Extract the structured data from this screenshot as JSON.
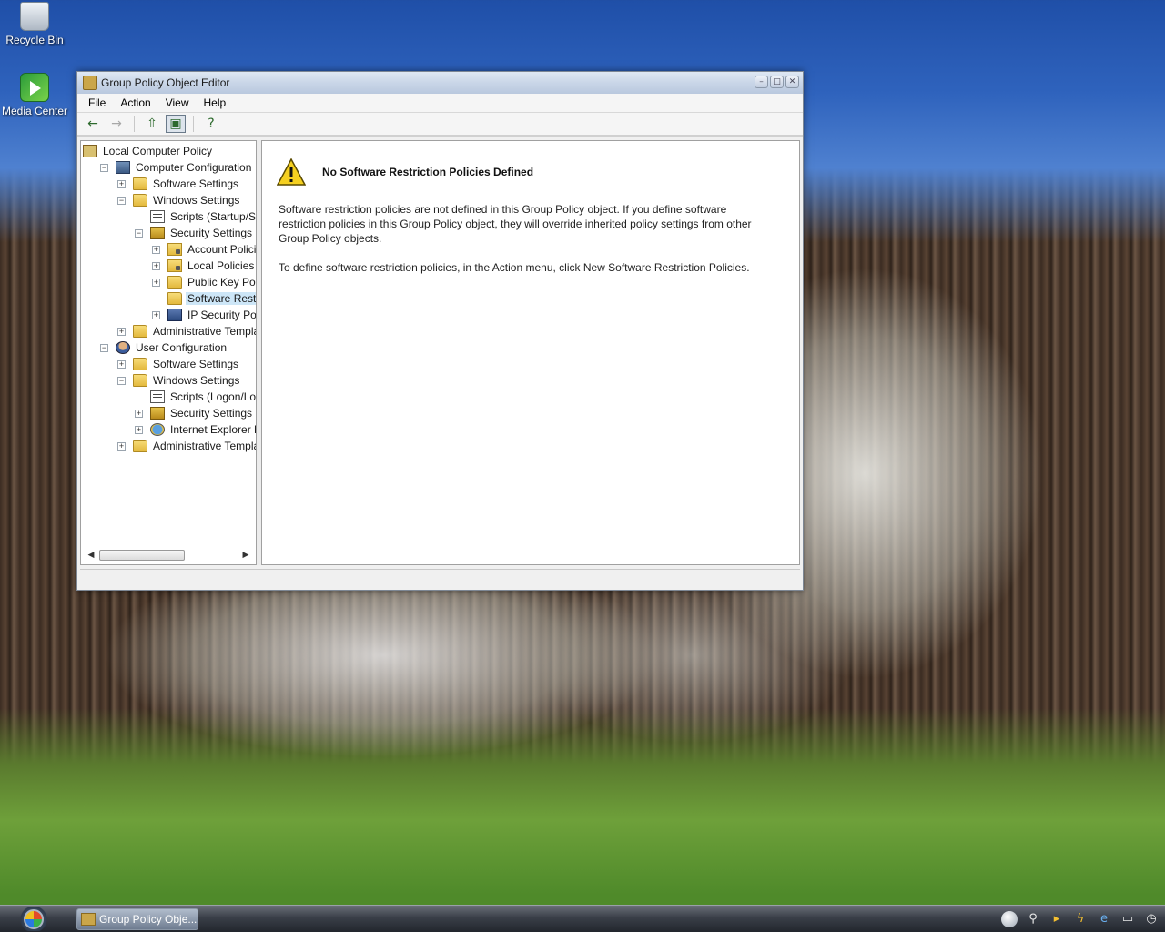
{
  "desktop": {
    "icons": [
      {
        "label": "Recycle Bin",
        "icon": "recycle-bin-icon"
      },
      {
        "label": "Media Center",
        "icon": "media-center-icon"
      }
    ]
  },
  "window": {
    "title": "Group Policy Object Editor",
    "controls": {
      "minimize": "–",
      "maximize": "□",
      "close": "✕"
    },
    "menu": [
      "File",
      "Action",
      "View",
      "Help"
    ],
    "toolbar": {
      "back": "←",
      "forward": "→",
      "up": "⇧",
      "show_hide": "▣",
      "help": "?"
    },
    "tree": {
      "nodes": [
        {
          "label": "Local Computer Policy",
          "icon": "policy-icon",
          "expander": ""
        },
        {
          "label": "Computer Configuration",
          "icon": "computer-icon",
          "expander": "−"
        },
        {
          "label": "Software Settings",
          "icon": "folder-icon",
          "expander": "+"
        },
        {
          "label": "Windows Settings",
          "icon": "folder-icon",
          "expander": "−"
        },
        {
          "label": "Scripts (Startup/Shut",
          "icon": "script-icon",
          "expander": ""
        },
        {
          "label": "Security Settings",
          "icon": "security-icon",
          "expander": "−"
        },
        {
          "label": "Account Policies",
          "icon": "folder-lock-icon",
          "expander": "+"
        },
        {
          "label": "Local Policies",
          "icon": "folder-lock-icon",
          "expander": "+"
        },
        {
          "label": "Public Key Policie",
          "icon": "folder-icon",
          "expander": "+"
        },
        {
          "label": "Software Restricti",
          "icon": "folder-icon",
          "expander": ""
        },
        {
          "label": "IP Security Policie",
          "icon": "ipsec-icon",
          "expander": "+"
        },
        {
          "label": "Administrative Template",
          "icon": "folder-icon",
          "expander": "+"
        },
        {
          "label": "User Configuration",
          "icon": "user-icon",
          "expander": "−"
        },
        {
          "label": "Software Settings",
          "icon": "folder-icon",
          "expander": "+"
        },
        {
          "label": "Windows Settings",
          "icon": "folder-icon",
          "expander": "−"
        },
        {
          "label": "Scripts (Logon/Logo",
          "icon": "script-icon",
          "expander": ""
        },
        {
          "label": "Security Settings",
          "icon": "security-icon",
          "expander": "+"
        },
        {
          "label": "Internet Explorer Mai",
          "icon": "ie-icon",
          "expander": "+"
        },
        {
          "label": "Administrative Template",
          "icon": "folder-icon",
          "expander": "+"
        }
      ],
      "selected_index": 9
    },
    "detail": {
      "heading": "No Software Restriction Policies Defined",
      "paragraph1": "Software restriction policies are not defined in this Group Policy object. If you define software restriction policies in this Group Policy object, they will override inherited policy settings from other Group Policy objects.",
      "paragraph2": "To define software restriction policies, in the Action menu, click New Software Restriction Policies."
    }
  },
  "taskbar": {
    "task_label": "Group Policy Obje...",
    "tray_icons": [
      "circle-icon",
      "search-icon",
      "folder-icon",
      "power-icon",
      "ie-icon",
      "window-icon",
      "clock-icon"
    ]
  }
}
